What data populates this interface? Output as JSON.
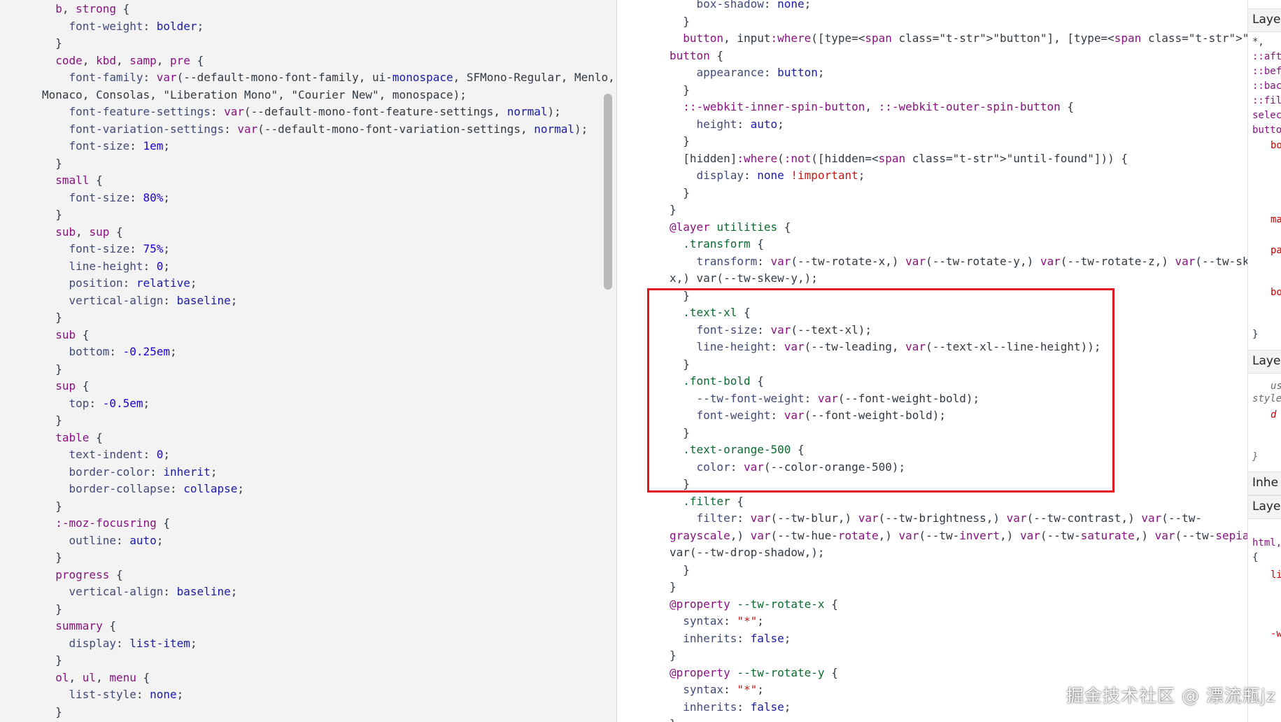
{
  "left_code": [
    "  b, strong {",
    "    font-weight: bolder;",
    "  }",
    "  code, kbd, samp, pre {",
    "    font-family: var(--default-mono-font-family, ui-monospace, SFMono-Regular, Menlo,",
    "Monaco, Consolas, \"Liberation Mono\", \"Courier New\", monospace);",
    "    font-feature-settings: var(--default-mono-font-feature-settings, normal);",
    "    font-variation-settings: var(--default-mono-font-variation-settings, normal);",
    "    font-size: 1em;",
    "  }",
    "  small {",
    "    font-size: 80%;",
    "  }",
    "  sub, sup {",
    "    font-size: 75%;",
    "    line-height: 0;",
    "    position: relative;",
    "    vertical-align: baseline;",
    "  }",
    "  sub {",
    "    bottom: -0.25em;",
    "  }",
    "  sup {",
    "    top: -0.5em;",
    "  }",
    "  table {",
    "    text-indent: 0;",
    "    border-color: inherit;",
    "    border-collapse: collapse;",
    "  }",
    "  :-moz-focusring {",
    "    outline: auto;",
    "  }",
    "  progress {",
    "    vertical-align: baseline;",
    "  }",
    "  summary {",
    "    display: list-item;",
    "  }",
    "  ol, ul, menu {",
    "    list-style: none;",
    "  }"
  ],
  "right_code": [
    "    box-shadow: none;",
    "  }",
    "  button, input:where([type=\"button\"], [type=\"reset\"], [type=\"submit\"]), ::file-selector-",
    "button {",
    "    appearance: button;",
    "  }",
    "  ::-webkit-inner-spin-button, ::-webkit-outer-spin-button {",
    "    height: auto;",
    "  }",
    "  [hidden]:where(:not([hidden=\"until-found\"])) {",
    "    display: none !important;",
    "  }",
    "}",
    "@layer utilities {",
    "  .transform {",
    "    transform: var(--tw-rotate-x,) var(--tw-rotate-y,) var(--tw-rotate-z,) var(--tw-skew-",
    "x,) var(--tw-skew-y,);",
    "  }",
    "  .text-xl {",
    "    font-size: var(--text-xl);",
    "    line-height: var(--tw-leading, var(--text-xl--line-height));",
    "  }",
    "  .font-bold {",
    "    --tw-font-weight: var(--font-weight-bold);",
    "    font-weight: var(--font-weight-bold);",
    "  }",
    "  .text-orange-500 {",
    "    color: var(--color-orange-500);",
    "  }",
    "  .filter {",
    "    filter: var(--tw-blur,) var(--tw-brightness,) var(--tw-contrast,) var(--tw-",
    "grayscale,) var(--tw-hue-rotate,) var(--tw-invert,) var(--tw-saturate,) var(--tw-sepia,)",
    "var(--tw-drop-shadow,);",
    "  }",
    "}",
    "@property --tw-rotate-x {",
    "  syntax: \"*\";",
    "  inherits: false;",
    "}",
    "@property --tw-rotate-y {",
    "  syntax: \"*\";",
    "  inherits: false;",
    "}"
  ],
  "far_panel": {
    "section_1": "Laye",
    "snippet_1": "*,",
    "snippet_2": "::aft",
    "snippet_3": "::bef",
    "snippet_4": "::bac",
    "snippet_5": "::fil",
    "snippet_6": "selec",
    "snippet_7": "butto",
    "snippet_8": "bo",
    "snippet_9": "ma",
    "snippet_10": "pa",
    "snippet_11": "bo",
    "brace_1": "}",
    "section_2": "Laye",
    "snippet_12": "us",
    "snippet_13": "style",
    "snippet_14": "d",
    "brace_2": "}",
    "section_3": "Inhe",
    "section_4": "Laye",
    "snippet_15": "html,",
    "snippet_16": "{",
    "snippet_17": "li",
    "snippet_18": "-w"
  },
  "watermark": "掘金技术社区 @ 漂流瓶jz",
  "colors": {
    "highlight_border": "#e0141e",
    "selector": "#881280",
    "class_selector": "#0a6a2e",
    "property": "#404a78",
    "number": "#1c00cf",
    "string": "#c41a16"
  }
}
